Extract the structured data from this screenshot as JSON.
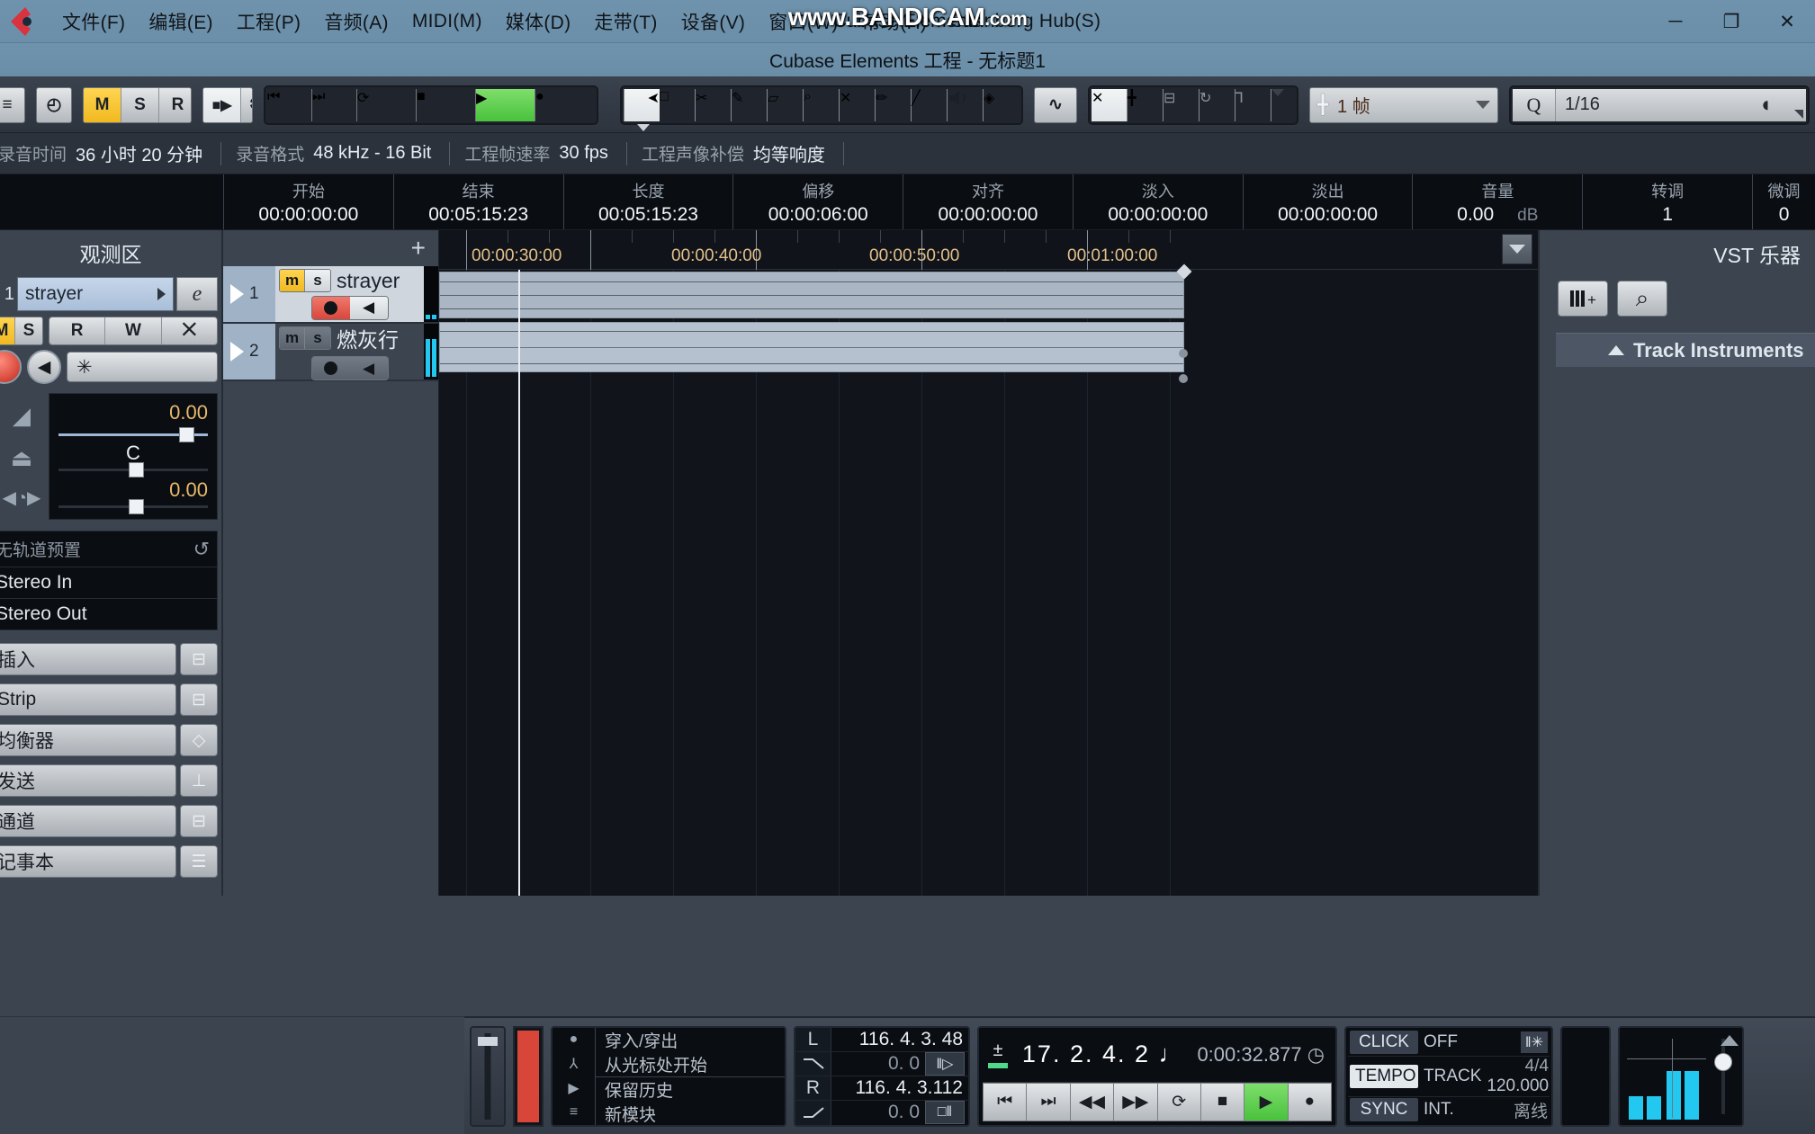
{
  "window": {
    "app_title": "Cubase Elements",
    "project_title": "Cubase Elements 工程 - 无标题1",
    "watermark_main": "www.BANDICAM",
    "watermark_suffix": ".com",
    "minimize": "─",
    "maximize": "❐",
    "close": "✕"
  },
  "menu": {
    "items": [
      {
        "label": "文件(F)"
      },
      {
        "label": "编辑(E)"
      },
      {
        "label": "工程(P)"
      },
      {
        "label": "音频(A)"
      },
      {
        "label": "MIDI(M)"
      },
      {
        "label": "媒体(D)"
      },
      {
        "label": "走带(T)"
      },
      {
        "label": "设备(V)"
      },
      {
        "label": "窗口(W)"
      },
      {
        "label": "帮助(H)"
      },
      {
        "label": "Steinberg Hub(S)"
      }
    ]
  },
  "toolbar": {
    "constrain_icon": "≡",
    "history_icon": "◴",
    "m_label": "M",
    "s_label": "S",
    "r_label": "R",
    "w_label": "W",
    "auto_icon": "■▶",
    "star_icon": "✱",
    "to_start_icon": "⏮",
    "to_end_icon": "⏭",
    "cycle_icon": "⟳",
    "stop_icon": "■",
    "play_icon": "▶",
    "record_icon": "●",
    "tools": [
      {
        "name": "arrow-tool",
        "glyph": "➤"
      },
      {
        "name": "range-tool",
        "glyph": "□"
      },
      {
        "name": "scissors-tool",
        "glyph": "✂"
      },
      {
        "name": "glue-tool",
        "glyph": "✎"
      },
      {
        "name": "eraser-tool",
        "glyph": "▱"
      },
      {
        "name": "zoom-tool",
        "glyph": "⌕"
      },
      {
        "name": "mute-tool",
        "glyph": "✕"
      },
      {
        "name": "draw-tool",
        "glyph": "✏"
      },
      {
        "name": "line-tool",
        "glyph": "╱"
      },
      {
        "name": "play-tool",
        "glyph": "ὐA"
      },
      {
        "name": "color-tool",
        "glyph": "◈"
      }
    ],
    "autoscroll_icon": "∿",
    "snap_x_icon": "✕",
    "grid_icon": "╋",
    "quantize_box_icon": "⊟",
    "cycle2_icon": "↻",
    "filter_icon": "⅂",
    "grid_type_icon": "╋",
    "grid_value": "1 帧",
    "q_label": "Q",
    "q_value": "1/16",
    "q_arrow": "◖"
  },
  "statusline": {
    "rec_time_label": "录音时间",
    "rec_time_value": "36 小时 20 分钟",
    "rec_format_label": "录音格式",
    "rec_format_value": "48 kHz - 16 Bit",
    "frame_rate_label": "工程帧速率",
    "frame_rate_value": "30 fps",
    "pan_law_label": "工程声像补偿",
    "pan_law_value": "均等响度"
  },
  "infoline": {
    "lead": "",
    "cells": [
      {
        "key": "开始",
        "value": "00:00:00:00",
        "unit": ""
      },
      {
        "key": "结束",
        "value": "00:05:15:23",
        "unit": ""
      },
      {
        "key": "长度",
        "value": "00:05:15:23",
        "unit": ""
      },
      {
        "key": "偏移",
        "value": "00:00:06:00",
        "unit": ""
      },
      {
        "key": "对齐",
        "value": "00:00:00:00",
        "unit": ""
      },
      {
        "key": "淡入",
        "value": "00:00:00:00",
        "unit": ""
      },
      {
        "key": "淡出",
        "value": "00:00:00:00",
        "unit": ""
      },
      {
        "key": "音量",
        "value": "0.00",
        "unit": "dB"
      },
      {
        "key": "转调",
        "value": "1",
        "unit": ""
      },
      {
        "key": "微调",
        "value": "0",
        "unit": ""
      }
    ]
  },
  "inspector": {
    "title": "观测区",
    "track_number": "1",
    "track_name": "strayer",
    "edit_button": "e",
    "mute_label": "M",
    "solo_label": "S",
    "read_label": "R",
    "write_label": "W",
    "auto_label": "⨉",
    "mono_label": "✳",
    "volume_value": "0.00",
    "pan_value": "C",
    "delay_value": "0.00",
    "icons": {
      "volume": "◢",
      "pan": "⏏",
      "delay": "◀◔▶",
      "reset": "↺"
    },
    "preset_header": "无轨道预置",
    "routing": [
      {
        "label": "Stereo In"
      },
      {
        "label": "Stereo Out"
      }
    ],
    "sections": [
      {
        "label": "插入",
        "icon": "⊟"
      },
      {
        "label": "Strip",
        "icon": "⊟"
      },
      {
        "label": "均衡器",
        "icon": "◇"
      },
      {
        "label": "发送",
        "icon": "⊥"
      },
      {
        "label": "通道",
        "icon": "⊟"
      },
      {
        "label": "记事本",
        "icon": "☰"
      }
    ]
  },
  "tracklist": {
    "add_track_icon": "+",
    "tracks": [
      {
        "number": "1",
        "name": "strayer",
        "selected": true,
        "mute": "m",
        "solo": "s",
        "mute_on": true,
        "record_armed": true,
        "monitor_icon": "◀",
        "record_icon": "●",
        "meter_bars": 2
      },
      {
        "number": "2",
        "name": "燃灰行",
        "selected": false,
        "mute": "m",
        "solo": "s",
        "mute_on": false,
        "record_armed": false,
        "monitor_icon": "◀",
        "record_icon": "●",
        "meter_bars": 2
      }
    ]
  },
  "ruler": {
    "labels": [
      "00:00:30:00",
      "00:00:40:00",
      "00:00:50:00",
      "00:01:00:00"
    ],
    "dropdown_icon": "▼"
  },
  "vst_panel": {
    "title": "VST 乐器",
    "add_instrument_icon": "‖+",
    "search_icon": "⌕",
    "track_instruments_label": "Track Instruments",
    "collapse_icon": "▲"
  },
  "transport": {
    "punch": {
      "items": [
        {
          "icon": "●",
          "label": "穿入/穿出"
        },
        {
          "icon": "⅄",
          "label": "从光标处开始"
        },
        {
          "icon": "▶",
          "label": "保留历史"
        },
        {
          "icon": "≡",
          "label": "新模块"
        }
      ]
    },
    "locators": {
      "left_tag": "L",
      "left_value": "116.  4.  3.  48",
      "left_sub": "0.      0",
      "left_mini": "‖▷",
      "right_tag": "R",
      "right_value": "116.  4.  3.112",
      "right_sub": "0.      0",
      "right_mini": "□‖"
    },
    "position": {
      "plus_minus": "±",
      "primary": "17.  2.  4.      2",
      "note_icon": "♩",
      "time": "0:00:32.877",
      "clock_icon": "◷",
      "buttons": [
        {
          "name": "to-start",
          "glyph": "⏮",
          "state": "normal"
        },
        {
          "name": "to-end",
          "glyph": "⏭",
          "state": "normal"
        },
        {
          "name": "rewind",
          "glyph": "◀◀",
          "state": "normal"
        },
        {
          "name": "forward",
          "glyph": "▶▶",
          "state": "normal"
        },
        {
          "name": "cycle",
          "glyph": "⟳",
          "state": "normal"
        },
        {
          "name": "stop",
          "glyph": "■",
          "state": "normal"
        },
        {
          "name": "play",
          "glyph": "▶",
          "state": "green"
        },
        {
          "name": "record",
          "glyph": "●",
          "state": "normal"
        }
      ]
    },
    "click_tempo_sync": {
      "click_tag": "CLICK",
      "click_value": "OFF",
      "click_chip": "‖✳",
      "tempo_tag": "TEMPO",
      "tempo_mode": "TRACK",
      "time_signature": "4/4",
      "tempo_value": "120.000",
      "sync_tag": "SYNC",
      "sync_value": "INT.",
      "sync_state": "离线"
    }
  },
  "colors": {
    "titlebar": "#6f93ad",
    "panel": "#3c4450",
    "dark": "#0a0d11",
    "accent_green": "#49c23d",
    "accent_yellow": "#f0b920",
    "accent_red": "#d9463a",
    "meter_cyan": "#23c8f0",
    "ruler_text": "#e3c08a"
  }
}
